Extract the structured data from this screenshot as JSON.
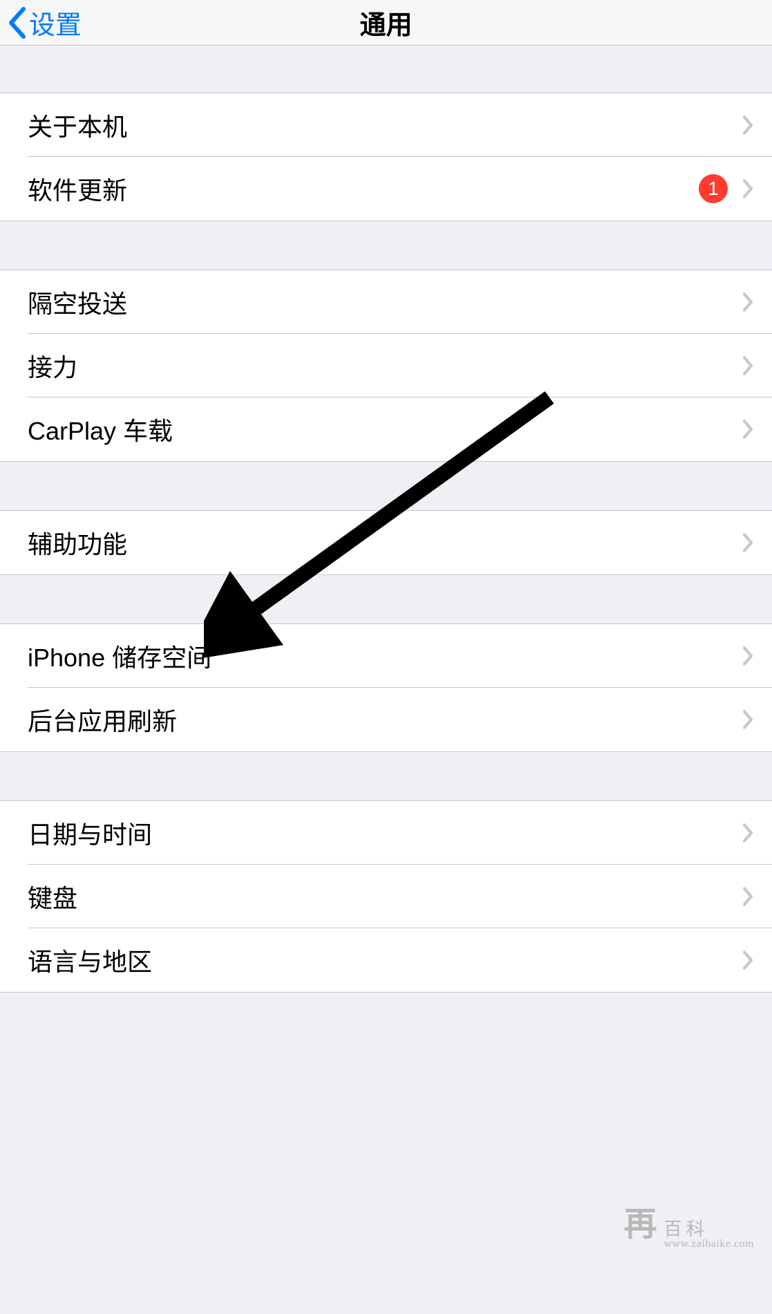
{
  "nav": {
    "back_label": "设置",
    "title": "通用"
  },
  "group1": [
    {
      "label": "关于本机",
      "badge": null
    },
    {
      "label": "软件更新",
      "badge": "1"
    }
  ],
  "group2": [
    {
      "label": "隔空投送"
    },
    {
      "label": "接力"
    },
    {
      "label": "CarPlay 车载"
    }
  ],
  "group3": [
    {
      "label": "辅助功能"
    }
  ],
  "group4": [
    {
      "label": "iPhone 储存空间"
    },
    {
      "label": "后台应用刷新"
    }
  ],
  "group5": [
    {
      "label": "日期与时间"
    },
    {
      "label": "键盘"
    },
    {
      "label": "语言与地区"
    }
  ],
  "watermark": {
    "char": "再",
    "text": "百 科",
    "url": "www.zaibaike.com"
  }
}
